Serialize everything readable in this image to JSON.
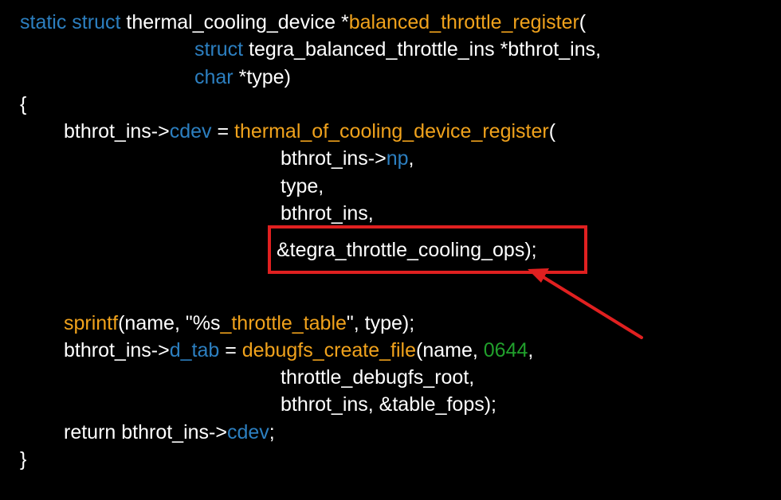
{
  "colors": {
    "background": "#000000",
    "plain": "#ffffff",
    "keyword": "#2c7fc0",
    "function": "#f0a21c",
    "number": "#21a02c",
    "highlight_box": "#e02020",
    "arrow": "#e02020"
  },
  "code": {
    "lines": [
      {
        "tokens": [
          {
            "text": "static ",
            "kind": "keyword"
          },
          {
            "text": "struct ",
            "kind": "keyword"
          },
          {
            "text": "thermal_cooling_device *",
            "kind": "plain"
          },
          {
            "text": "balanced_throttle_register",
            "kind": "function"
          },
          {
            "text": "(",
            "kind": "plain"
          }
        ]
      },
      {
        "tokens": [
          {
            "text": "struct ",
            "kind": "keyword"
          },
          {
            "text": "tegra_balanced_throttle_ins *bthrot_ins,",
            "kind": "plain"
          }
        ]
      },
      {
        "tokens": [
          {
            "text": "char ",
            "kind": "keyword"
          },
          {
            "text": "*type)",
            "kind": "plain"
          }
        ]
      },
      {
        "tokens": [
          {
            "text": "{",
            "kind": "plain"
          }
        ]
      },
      {
        "tokens": [
          {
            "text": "bthrot_ins->",
            "kind": "plain"
          },
          {
            "text": "cdev",
            "kind": "keyword"
          },
          {
            "text": " = ",
            "kind": "plain"
          },
          {
            "text": "thermal_of_cooling_device_register",
            "kind": "function"
          },
          {
            "text": "(",
            "kind": "plain"
          }
        ]
      },
      {
        "tokens": [
          {
            "text": "bthrot_ins->",
            "kind": "plain"
          },
          {
            "text": "np",
            "kind": "keyword"
          },
          {
            "text": ",",
            "kind": "plain"
          }
        ]
      },
      {
        "tokens": [
          {
            "text": "type,",
            "kind": "plain"
          }
        ]
      },
      {
        "tokens": [
          {
            "text": "bthrot_ins,",
            "kind": "plain"
          }
        ]
      },
      {
        "tokens": [
          {
            "text": "&tegra_throttle_cooling_ops);",
            "kind": "plain"
          }
        ]
      },
      {
        "tokens": [
          {
            "text": "sprintf",
            "kind": "function"
          },
          {
            "text": "(name, \"%s",
            "kind": "plain"
          },
          {
            "text": "_throttle_table",
            "kind": "function"
          },
          {
            "text": "\", type);",
            "kind": "plain"
          }
        ]
      },
      {
        "tokens": [
          {
            "text": "bthrot_ins->",
            "kind": "plain"
          },
          {
            "text": "d_tab",
            "kind": "keyword"
          },
          {
            "text": " = ",
            "kind": "plain"
          },
          {
            "text": "debugfs_create_file",
            "kind": "function"
          },
          {
            "text": "(name, ",
            "kind": "plain"
          },
          {
            "text": "0644",
            "kind": "number"
          },
          {
            "text": ",",
            "kind": "plain"
          }
        ]
      },
      {
        "tokens": [
          {
            "text": "throttle_debugfs_root,",
            "kind": "plain"
          }
        ]
      },
      {
        "tokens": [
          {
            "text": "bthrot_ins, &table_fops);",
            "kind": "plain"
          }
        ]
      },
      {
        "tokens": [
          {
            "text": "return bthrot_ins->",
            "kind": "plain"
          },
          {
            "text": "cdev",
            "kind": "keyword"
          },
          {
            "text": ";",
            "kind": "plain"
          }
        ]
      },
      {
        "tokens": [
          {
            "text": "}",
            "kind": "plain"
          }
        ]
      }
    ]
  }
}
